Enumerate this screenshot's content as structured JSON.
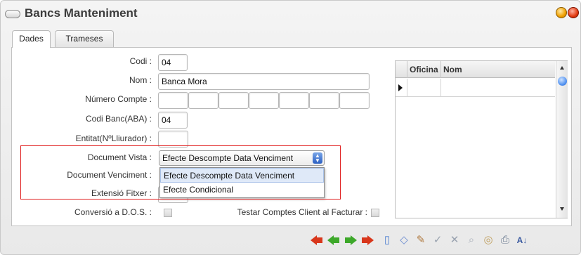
{
  "window": {
    "title": "Bancs Manteniment"
  },
  "tabs": [
    {
      "label": "Dades",
      "active": true
    },
    {
      "label": "Trameses",
      "active": false
    }
  ],
  "form": {
    "codi": {
      "label": "Codi :",
      "value": "04"
    },
    "nom": {
      "label": "Nom :",
      "value": "Banca Mora"
    },
    "numero_compte": {
      "label": "Número Compte :",
      "segments": [
        "",
        "",
        "",
        "",
        "",
        "",
        "",
        ""
      ]
    },
    "codi_banc": {
      "label": "Codi Banc(ABA) :",
      "value": "04"
    },
    "entitat": {
      "label": "Entitat(NºLliurador) :",
      "value": ""
    },
    "document_vista": {
      "label": "Document Vista :",
      "selected": "Efecte Descompte Data Venciment",
      "options": [
        "Efecte Descompte Data Venciment",
        "Efecte Condicional"
      ]
    },
    "document_venciment": {
      "label": "Document Venciment :"
    },
    "extensio_fitxer": {
      "label": "Extensió Fitxer :"
    },
    "conversio_dos": {
      "label": "Conversió a D.O.S. :",
      "checked": false
    },
    "testar_comptes": {
      "label": "Testar Comptes Client al Facturar :",
      "checked": false
    }
  },
  "grid": {
    "columns": [
      "Oficina",
      "Nom"
    ],
    "rows": [
      [
        "",
        ""
      ]
    ]
  },
  "toolbar": {
    "icons": [
      "first-icon",
      "previous-icon",
      "next-icon",
      "last-icon",
      "new-document-icon",
      "erase-icon",
      "edit-icon",
      "accept-icon",
      "cancel-icon",
      "search-icon",
      "view-icon",
      "print-icon",
      "sort-az-icon"
    ]
  }
}
